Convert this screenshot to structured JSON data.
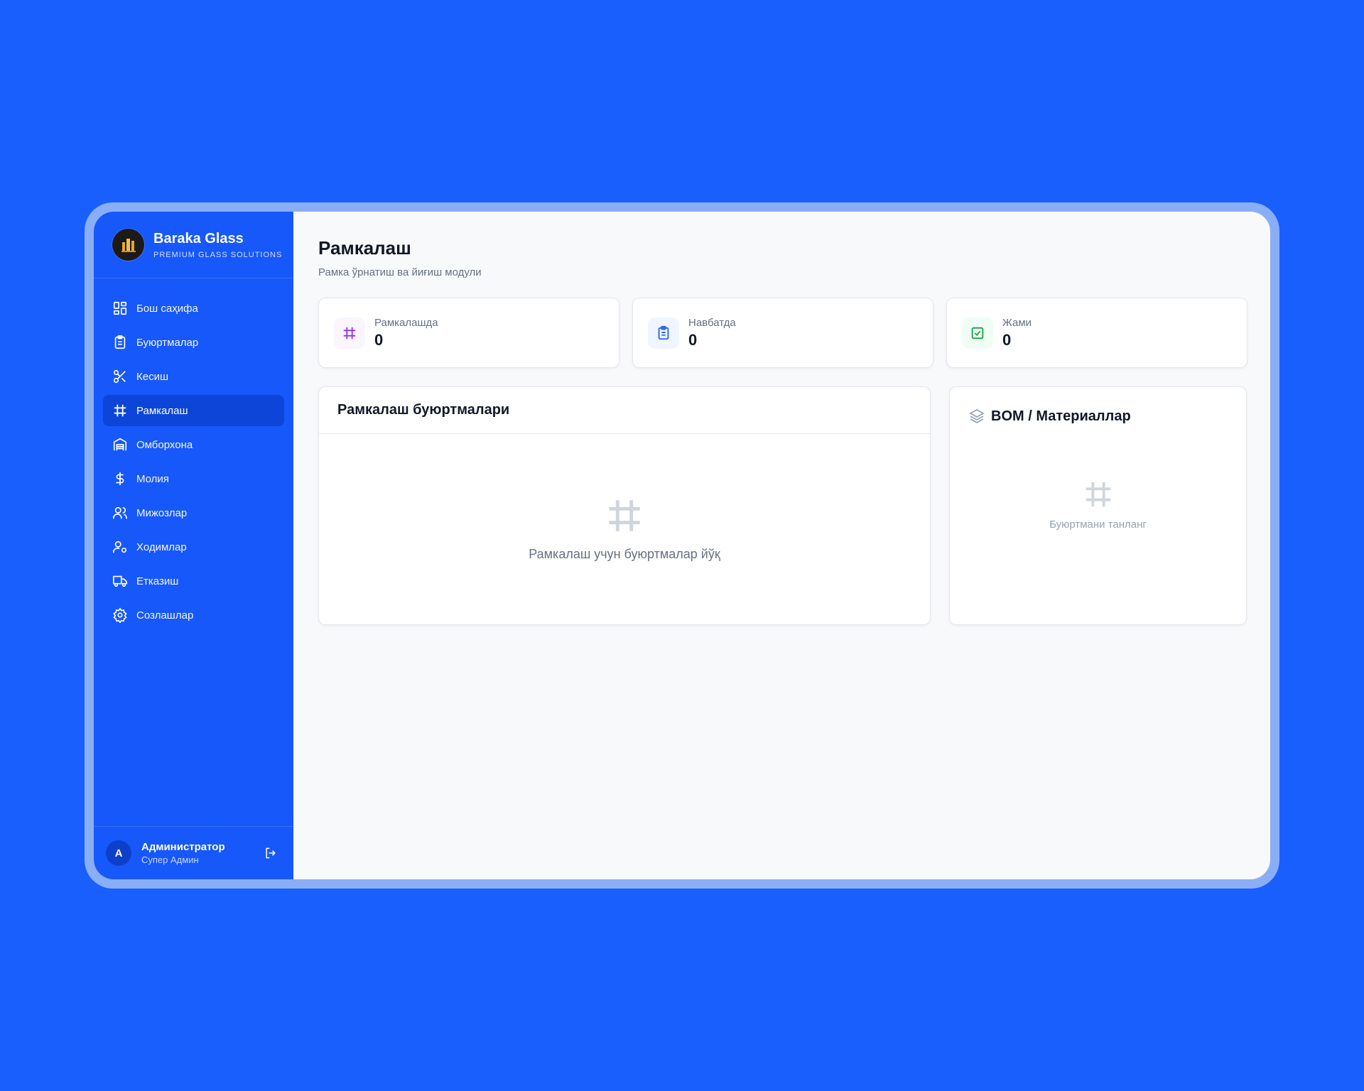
{
  "brand": {
    "name": "Baraka Glass",
    "tagline": "PREMIUM GLASS SOLUTIONS"
  },
  "sidebar": {
    "items": [
      {
        "label": "Бош саҳифа",
        "icon": "grid-icon"
      },
      {
        "label": "Буюртмалар",
        "icon": "clipboard-icon"
      },
      {
        "label": "Кесиш",
        "icon": "scissors-icon"
      },
      {
        "label": "Рамкалаш",
        "icon": "hash-icon",
        "active": true
      },
      {
        "label": "Омборхона",
        "icon": "warehouse-icon"
      },
      {
        "label": "Молия",
        "icon": "dollar-icon"
      },
      {
        "label": "Мижозлар",
        "icon": "users-icon"
      },
      {
        "label": "Ходимлар",
        "icon": "user-cog-icon"
      },
      {
        "label": "Етказиш",
        "icon": "truck-icon"
      },
      {
        "label": "Созлашлар",
        "icon": "gear-icon"
      }
    ]
  },
  "user": {
    "initial": "A",
    "name": "Администратор",
    "role": "Супер Админ"
  },
  "page": {
    "title": "Рамкалаш",
    "subtitle": "Рамка ўрнатиш ва йиғиш модули"
  },
  "stats": [
    {
      "label": "Рамкалашда",
      "value": "0",
      "color": "#9333EA",
      "bg": "#FAF5FF"
    },
    {
      "label": "Навбатда",
      "value": "0",
      "color": "#2563EB",
      "bg": "#EFF6FF"
    },
    {
      "label": "Жами",
      "value": "0",
      "color": "#16A34A",
      "bg": "#F0FDF4"
    }
  ],
  "orders_panel": {
    "title": "Рамкалаш буюртмалари",
    "empty": "Рамкалаш учун буюртмалар йўқ"
  },
  "bom_panel": {
    "title": "BOM / Материаллар",
    "empty": "Буюртмани танланг"
  },
  "colors": {
    "primary": "#1758FB",
    "background": "#185FFE",
    "active": "#0D45D9"
  }
}
